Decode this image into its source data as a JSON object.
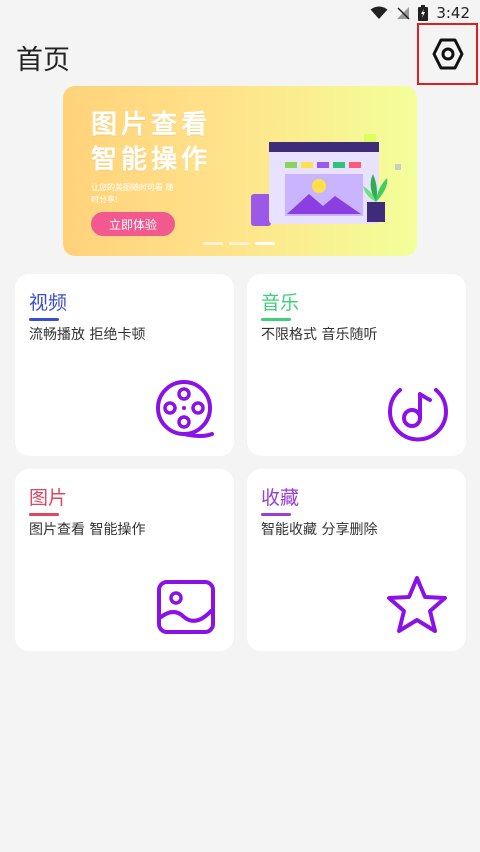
{
  "status_bar": {
    "time": "3:42",
    "icons": [
      "wifi-icon",
      "no-signal-icon",
      "battery-charging-icon"
    ]
  },
  "header": {
    "title": "首页",
    "settings_icon": "settings-hexagon-icon"
  },
  "banner": {
    "headline_line1": "图片查看",
    "headline_line2": "智能操作",
    "subtitle": "让您的美图随时可看 随时分享!",
    "button_label": "立即体验",
    "page_count": 3,
    "active_page": 3
  },
  "cards": [
    {
      "title": "视频",
      "subtitle": "流畅播放 拒绝卡顿",
      "color": "#3a4fcf",
      "icon": "film-reel-icon"
    },
    {
      "title": "音乐",
      "subtitle": "不限格式 音乐随听",
      "color": "#3fcf7a",
      "icon": "music-note-icon"
    },
    {
      "title": "图片",
      "subtitle": "图片查看 智能操作",
      "color": "#e0465f",
      "icon": "image-icon"
    },
    {
      "title": "收藏",
      "subtitle": "智能收藏 分享删除",
      "color": "#9a3ed6",
      "icon": "star-icon"
    }
  ],
  "colors": {
    "accent_purple": "#8a12e6",
    "settings_highlight": "#e02020",
    "banner_button": "#f25a8f"
  }
}
